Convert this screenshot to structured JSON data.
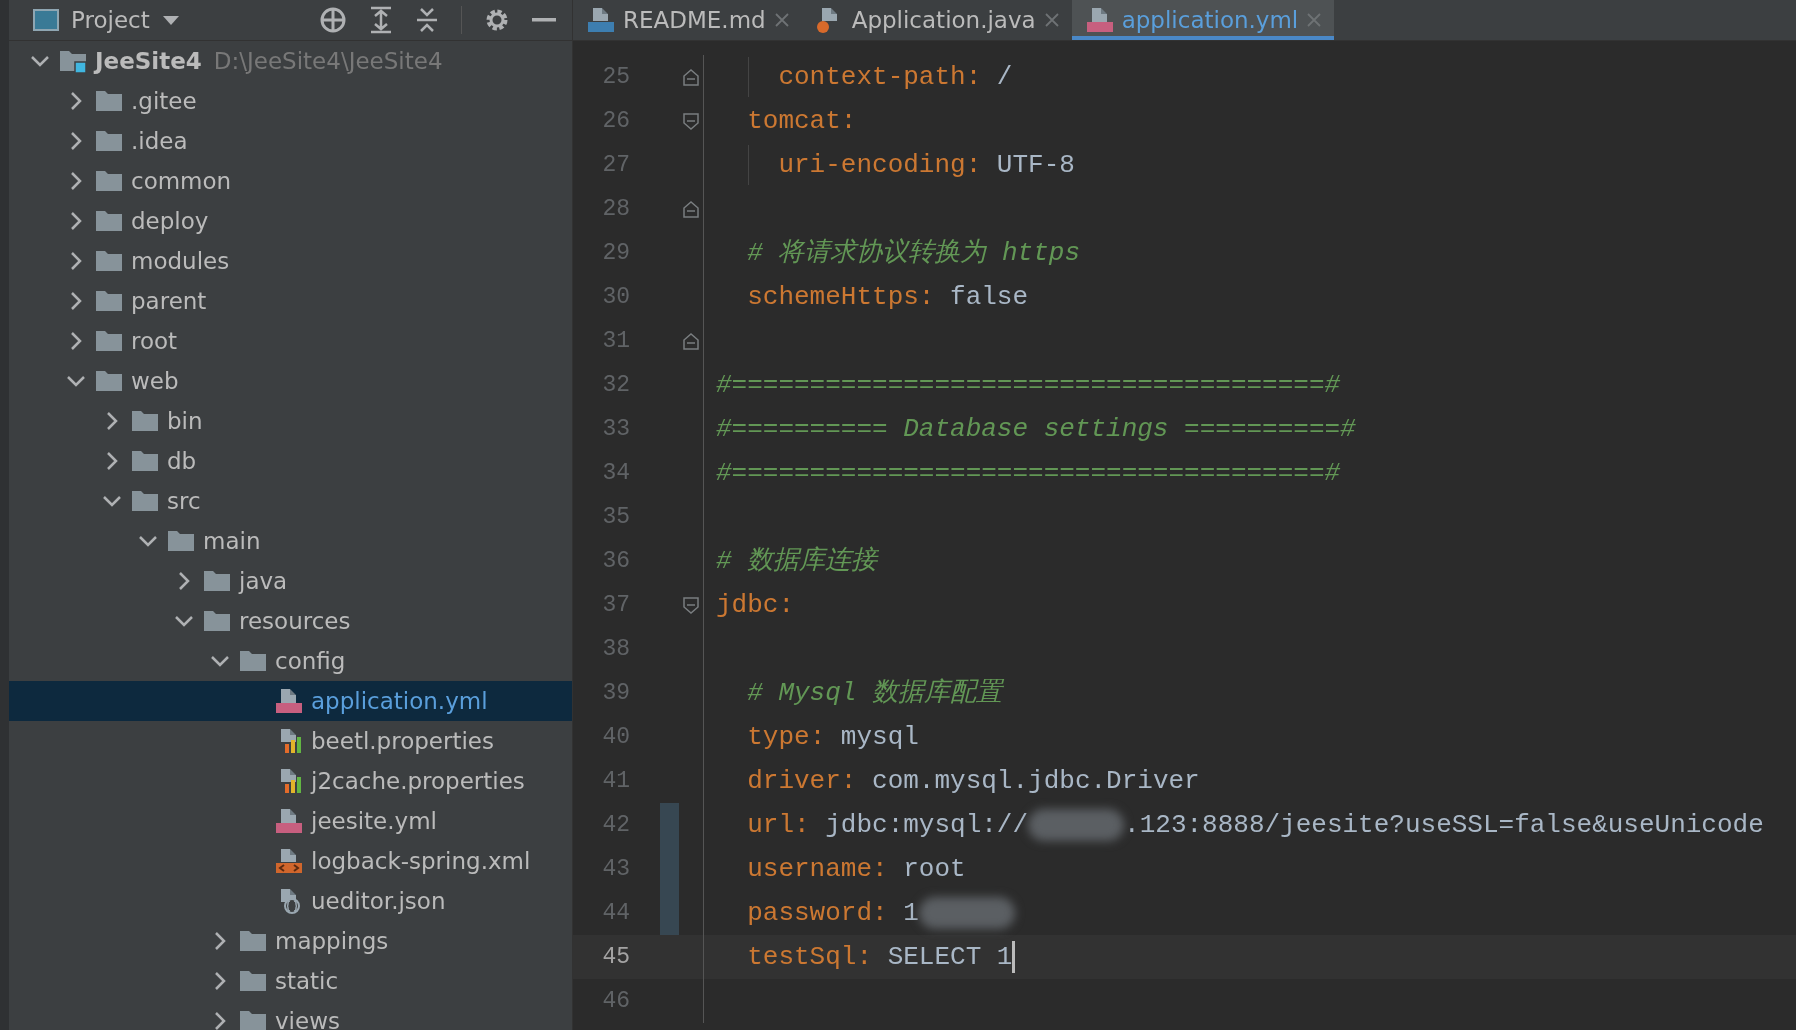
{
  "project_panel": {
    "title": "Project",
    "tree": [
      {
        "label": "JeeSite4",
        "path": "D:\\JeeSite4\\JeeSite4",
        "kind": "module",
        "expanded": true,
        "selected": false,
        "children": [
          {
            "label": ".gitee",
            "kind": "folder",
            "expanded": false,
            "selected": false
          },
          {
            "label": ".idea",
            "kind": "folder",
            "expanded": false,
            "selected": false
          },
          {
            "label": "common",
            "kind": "folder",
            "expanded": false,
            "selected": false
          },
          {
            "label": "deploy",
            "kind": "folder",
            "expanded": false,
            "selected": false
          },
          {
            "label": "modules",
            "kind": "folder",
            "expanded": false,
            "selected": false
          },
          {
            "label": "parent",
            "kind": "folder",
            "expanded": false,
            "selected": false
          },
          {
            "label": "root",
            "kind": "folder",
            "expanded": false,
            "selected": false
          },
          {
            "label": "web",
            "kind": "folder",
            "expanded": true,
            "selected": false,
            "children": [
              {
                "label": "bin",
                "kind": "folder",
                "expanded": false,
                "selected": false
              },
              {
                "label": "db",
                "kind": "folder",
                "expanded": false,
                "selected": false
              },
              {
                "label": "src",
                "kind": "folder",
                "expanded": true,
                "selected": false,
                "children": [
                  {
                    "label": "main",
                    "kind": "folder",
                    "expanded": true,
                    "selected": false,
                    "children": [
                      {
                        "label": "java",
                        "kind": "folder",
                        "expanded": false,
                        "selected": false
                      },
                      {
                        "label": "resources",
                        "kind": "folder",
                        "expanded": true,
                        "selected": false,
                        "children": [
                          {
                            "label": "config",
                            "kind": "folder",
                            "expanded": true,
                            "selected": false,
                            "children": [
                              {
                                "label": "application.yml",
                                "kind": "yml",
                                "selected": true
                              },
                              {
                                "label": "beetl.properties",
                                "kind": "properties",
                                "selected": false
                              },
                              {
                                "label": "j2cache.properties",
                                "kind": "properties",
                                "selected": false
                              },
                              {
                                "label": "jeesite.yml",
                                "kind": "yml",
                                "selected": false
                              },
                              {
                                "label": "logback-spring.xml",
                                "kind": "xml",
                                "selected": false
                              },
                              {
                                "label": "ueditor.json",
                                "kind": "json",
                                "selected": false
                              }
                            ]
                          },
                          {
                            "label": "mappings",
                            "kind": "folder",
                            "expanded": false,
                            "selected": false
                          },
                          {
                            "label": "static",
                            "kind": "folder",
                            "expanded": false,
                            "selected": false
                          },
                          {
                            "label": "views",
                            "kind": "folder",
                            "expanded": false,
                            "selected": false
                          }
                        ]
                      }
                    ]
                  }
                ]
              }
            ]
          }
        ]
      }
    ]
  },
  "tabs": [
    {
      "label": "README.md",
      "kind": "md",
      "selected": false
    },
    {
      "label": "Application.java",
      "kind": "java",
      "selected": false
    },
    {
      "label": "application.yml",
      "kind": "yml",
      "selected": true
    }
  ],
  "editor": {
    "lines": [
      {
        "number": "25",
        "fold_start": false,
        "fold_end": true,
        "guide": true,
        "current": false,
        "changed": false,
        "parts": [
          {
            "kind": "key",
            "text": "    context-path"
          },
          {
            "kind": "punct",
            "text": ": "
          },
          {
            "kind": "value",
            "text": "/"
          }
        ]
      },
      {
        "number": "26",
        "fold_start": true,
        "fold_end": false,
        "guide": false,
        "current": false,
        "changed": false,
        "parts": [
          {
            "kind": "key",
            "text": "  tomcat"
          },
          {
            "kind": "punct",
            "text": ":"
          }
        ]
      },
      {
        "number": "27",
        "fold_start": false,
        "fold_end": false,
        "guide": true,
        "current": false,
        "changed": false,
        "parts": [
          {
            "kind": "key",
            "text": "    uri-encoding"
          },
          {
            "kind": "punct",
            "text": ": "
          },
          {
            "kind": "value",
            "text": "UTF-8"
          }
        ]
      },
      {
        "number": "28",
        "fold_start": false,
        "fold_end": true,
        "guide": false,
        "current": false,
        "changed": false
      },
      {
        "number": "29",
        "fold_start": false,
        "fold_end": false,
        "guide": false,
        "current": false,
        "changed": false,
        "parts": [
          {
            "kind": "comment",
            "text": "  # 将请求协议转换为 https"
          }
        ]
      },
      {
        "number": "30",
        "fold_start": false,
        "fold_end": false,
        "guide": false,
        "current": false,
        "changed": false,
        "parts": [
          {
            "kind": "key",
            "text": "  schemeHttps"
          },
          {
            "kind": "punct",
            "text": ": "
          },
          {
            "kind": "value",
            "text": "false"
          }
        ]
      },
      {
        "number": "31",
        "fold_start": false,
        "fold_end": true,
        "guide": false,
        "current": false,
        "changed": false
      },
      {
        "number": "32",
        "fold_start": false,
        "fold_end": false,
        "guide": false,
        "current": false,
        "changed": false,
        "parts": [
          {
            "kind": "comment",
            "text": "#======================================#"
          }
        ]
      },
      {
        "number": "33",
        "fold_start": false,
        "fold_end": false,
        "guide": false,
        "current": false,
        "changed": false,
        "parts": [
          {
            "kind": "comment",
            "text": "#========== Database settings ==========#"
          }
        ]
      },
      {
        "number": "34",
        "fold_start": false,
        "fold_end": false,
        "guide": false,
        "current": false,
        "changed": false,
        "parts": [
          {
            "kind": "comment",
            "text": "#======================================#"
          }
        ]
      },
      {
        "number": "35",
        "fold_start": false,
        "fold_end": false,
        "guide": false,
        "current": false,
        "changed": false
      },
      {
        "number": "36",
        "fold_start": false,
        "fold_end": false,
        "guide": false,
        "current": false,
        "changed": false,
        "parts": [
          {
            "kind": "comment",
            "text": "# 数据库连接"
          }
        ]
      },
      {
        "number": "37",
        "fold_start": true,
        "fold_end": false,
        "guide": false,
        "current": false,
        "changed": false,
        "parts": [
          {
            "kind": "key",
            "text": "jdbc"
          },
          {
            "kind": "punct",
            "text": ":"
          }
        ]
      },
      {
        "number": "38",
        "fold_start": false,
        "fold_end": false,
        "guide": false,
        "current": false,
        "changed": false
      },
      {
        "number": "39",
        "fold_start": false,
        "fold_end": false,
        "guide": false,
        "current": false,
        "changed": false,
        "parts": [
          {
            "kind": "comment",
            "text": "  # Mysql 数据库配置"
          }
        ]
      },
      {
        "number": "40",
        "fold_start": false,
        "fold_end": false,
        "guide": false,
        "current": false,
        "changed": false,
        "parts": [
          {
            "kind": "key",
            "text": "  type"
          },
          {
            "kind": "punct",
            "text": ": "
          },
          {
            "kind": "value",
            "text": "mysql"
          }
        ]
      },
      {
        "number": "41",
        "fold_start": false,
        "fold_end": false,
        "guide": false,
        "current": false,
        "changed": false,
        "parts": [
          {
            "kind": "key",
            "text": "  driver"
          },
          {
            "kind": "punct",
            "text": ": "
          },
          {
            "kind": "value",
            "text": "com.mysql.jdbc.Driver"
          }
        ]
      },
      {
        "number": "42",
        "fold_start": false,
        "fold_end": false,
        "guide": false,
        "current": false,
        "changed": true,
        "parts": [
          {
            "kind": "key",
            "text": "  url"
          },
          {
            "kind": "punct",
            "text": ": "
          },
          {
            "kind": "value",
            "text": "jdbc:mysql://"
          },
          {
            "kind": "redacted"
          },
          {
            "kind": "value",
            "text": ".123:8888/jeesite?useSSL=false&useUnicode"
          }
        ]
      },
      {
        "number": "43",
        "fold_start": false,
        "fold_end": false,
        "guide": false,
        "current": false,
        "changed": true,
        "parts": [
          {
            "kind": "key",
            "text": "  username"
          },
          {
            "kind": "punct",
            "text": ": "
          },
          {
            "kind": "value",
            "text": "root"
          }
        ]
      },
      {
        "number": "44",
        "fold_start": false,
        "fold_end": false,
        "guide": false,
        "current": false,
        "changed": true,
        "parts": [
          {
            "kind": "key",
            "text": "  password"
          },
          {
            "kind": "punct",
            "text": ": "
          },
          {
            "kind": "value",
            "text": "1"
          },
          {
            "kind": "redacted"
          }
        ]
      },
      {
        "number": "45",
        "fold_start": false,
        "fold_end": false,
        "guide": false,
        "current": true,
        "changed": false,
        "parts": [
          {
            "kind": "key",
            "text": "  testSql"
          },
          {
            "kind": "punct",
            "text": ": "
          },
          {
            "kind": "value",
            "text": "SELECT 1"
          }
        ]
      },
      {
        "number": "46",
        "fold_start": false,
        "fold_end": false,
        "guide": false,
        "current": false,
        "changed": false
      }
    ]
  }
}
